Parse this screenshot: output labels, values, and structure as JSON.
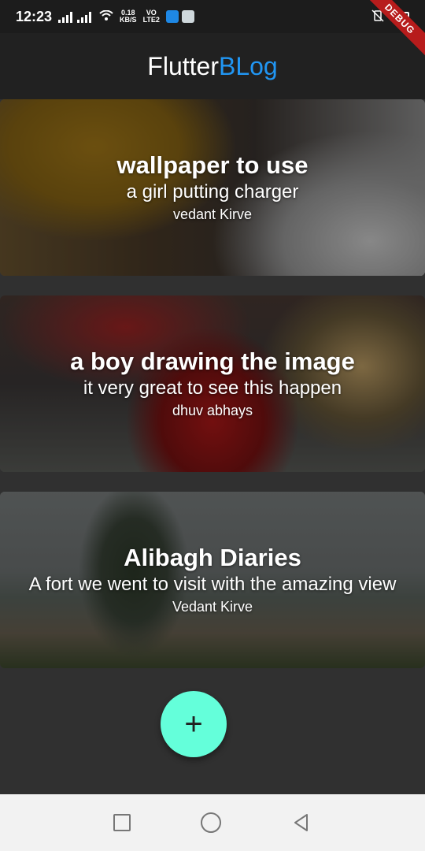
{
  "status_bar": {
    "time": "12:23",
    "speed_value": "0.18",
    "speed_unit": "KB/S",
    "network_top": "VO",
    "network_bottom": "LTE2",
    "battery_level": 0.6
  },
  "debug_banner": "DEBUG",
  "app_bar": {
    "title_part1": "Flutter",
    "title_part2": "BLog"
  },
  "posts": [
    {
      "title": "wallpaper to use",
      "description": "a girl putting charger",
      "author": "vedant Kirve"
    },
    {
      "title": "a boy drawing the image",
      "description": "it very great to see this happen",
      "author": "dhuv abhays"
    },
    {
      "title": "Alibagh Diaries",
      "description": "A fort we went to visit with the amazing view",
      "author": "Vedant Kirve"
    }
  ],
  "fab": {
    "label": "+"
  },
  "colors": {
    "accent": "#2196f3",
    "fab": "#64ffda",
    "background": "#303030",
    "app_bar": "#212121"
  }
}
